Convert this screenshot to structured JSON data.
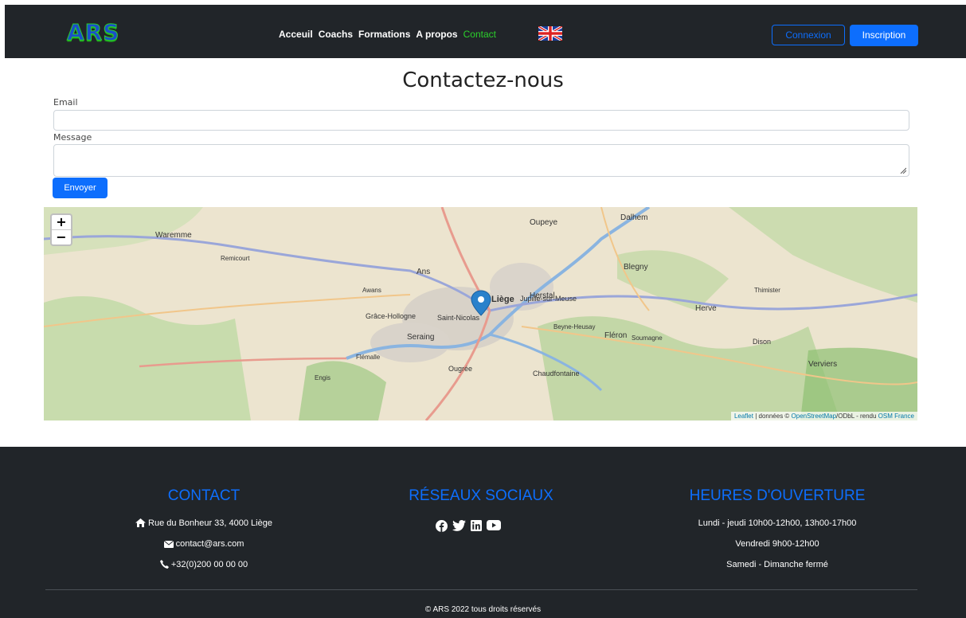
{
  "navbar": {
    "logo": "ARS",
    "links": [
      "Acceuil",
      "Coachs",
      "Formations",
      "A propos",
      "Contact"
    ],
    "active_link": "Contact",
    "language_icon": "uk-flag-icon",
    "login_label": "Connexion",
    "signup_label": "Inscription"
  },
  "contact_form": {
    "title": "Contactez-nous",
    "email_label": "Email",
    "email_value": "",
    "message_label": "Message",
    "message_value": "",
    "submit_label": "Envoyer"
  },
  "map": {
    "zoom_in": "+",
    "zoom_out": "−",
    "attribution_leaflet": "Leaflet",
    "attribution_sep1": " | données © ",
    "attribution_osm": "OpenStreetMap",
    "attribution_sep2": "/ODbL - rendu ",
    "attribution_osmfr": "OSM France",
    "place_labels": [
      "Oupeye",
      "Dalhem",
      "Herstal",
      "Blegny",
      "Awans",
      "Ans",
      "Grâce-Hollogne",
      "Saint-Nicolas",
      "Seraing",
      "Liège",
      "Jupille-sur-Meuse",
      "Fléron",
      "Soumagne",
      "Herve",
      "Thimister",
      "Chaudfontaine",
      "Ougrée",
      "Flémalle",
      "Engis",
      "Remicourt",
      "Waremme",
      "Verviers",
      "Dison",
      "Beyne-Heusay"
    ]
  },
  "footer": {
    "contact": {
      "title": "CONTACT",
      "address": "Rue du Bonheur 33, 4000 Liège",
      "email": "contact@ars.com",
      "phone": "+32(0)200 00 00 00"
    },
    "social": {
      "title": "RÉSEAUX SOCIAUX",
      "icons": [
        "facebook-icon",
        "twitter-icon",
        "linkedin-icon",
        "youtube-icon"
      ]
    },
    "hours": {
      "title": "HEURES D'OUVERTURE",
      "line1": "Lundi - jeudi 10h00-12h00, 13h00-17h00",
      "line2": "Vendredi 9h00-12h00",
      "line3": "Samedi - Dimanche fermé"
    },
    "copyright": "© ARS 2022 tous droits réservés"
  },
  "colors": {
    "navbar_bg": "#212529",
    "primary": "#0d6efd",
    "active_link": "#2bd02b"
  }
}
